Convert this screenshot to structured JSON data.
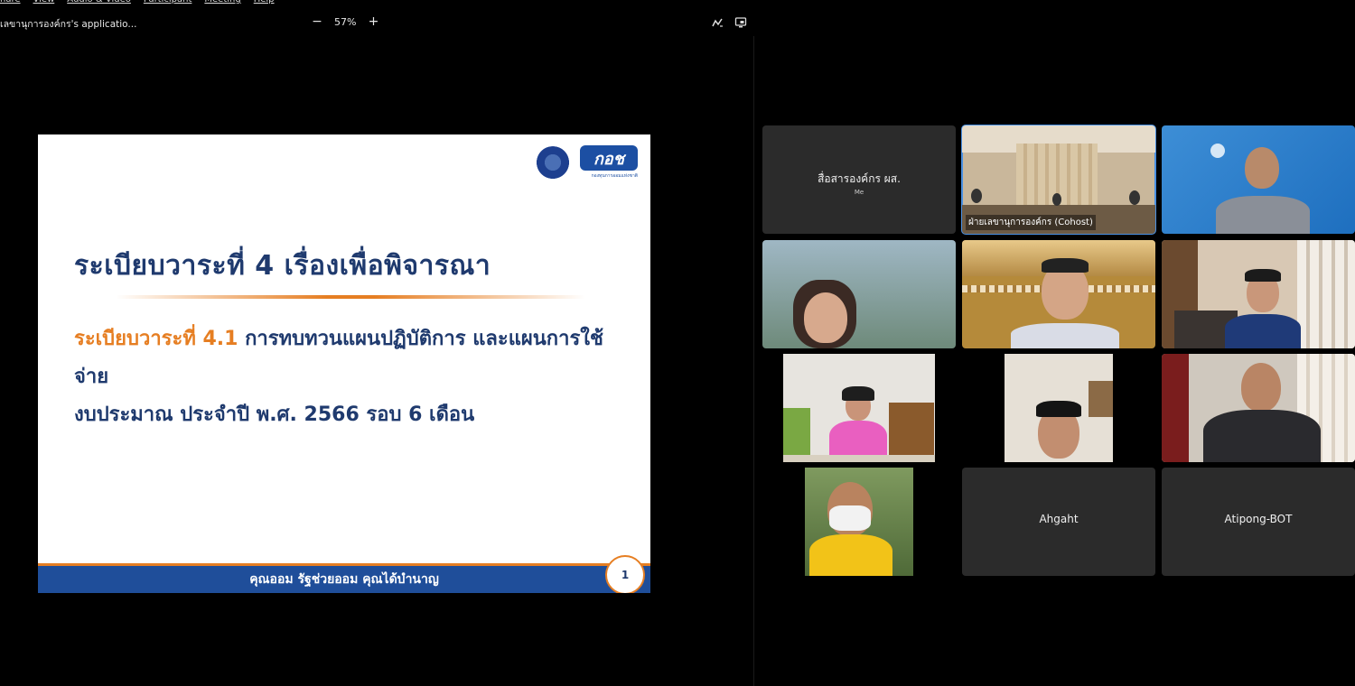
{
  "menu": {
    "items": [
      "hare",
      "View",
      "Audio & Video",
      "Participant",
      "Meeting",
      "Help"
    ]
  },
  "share_bar": {
    "title": "เลขานุการองค์กร's applicatio...",
    "zoom_minus": "−",
    "zoom_level": "57%",
    "zoom_plus": "+"
  },
  "slide": {
    "title": "ระเบียบวาระที่ 4 เรื่องเพื่อพิจารณา",
    "item_prefix": "ระเบียบวาระที่ 4.1",
    "item_text_line1": " การทบทวนแผนปฏิบัติการ และแผนการใช้จ่าย",
    "item_text_line2": "งบประมาณ ประจำปี พ.ศ. 2566 รอบ 6 เดือน",
    "footer": "คุณออม รัฐช่วยออม คุณได้บำนาญ",
    "page_number": "1",
    "logo_text": "กอช",
    "logo_subtext": "กองทุนการออมแห่งชาติ"
  },
  "participants": [
    {
      "name": "สื่อสารองค์กร ผส.",
      "sub": "Me",
      "video": false
    },
    {
      "name": "ฝ่ายเลขานุการองค์กร (Cohost)",
      "video": true,
      "active": true
    },
    {
      "name": "",
      "video": true
    },
    {
      "name": "",
      "video": true
    },
    {
      "name": "",
      "video": true
    },
    {
      "name": "",
      "video": true
    },
    {
      "name": "",
      "video": true
    },
    {
      "name": "",
      "video": true
    },
    {
      "name": "",
      "video": true
    },
    {
      "name": "",
      "video": true
    },
    {
      "name": "Ahgaht",
      "video": false
    },
    {
      "name": "Atipong-BOT",
      "video": false
    }
  ],
  "colors": {
    "accent_orange": "#e67e22",
    "slide_navy": "#1f3a6e",
    "footer_blue": "#1f4e9a",
    "active_speaker": "#4a90e2"
  }
}
